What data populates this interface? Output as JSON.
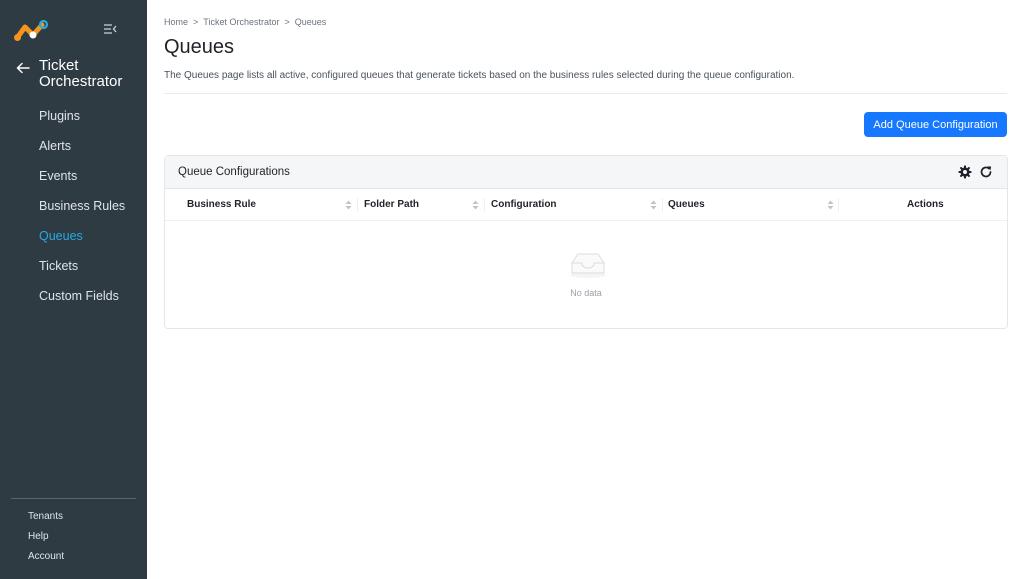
{
  "sidebar": {
    "back_title": "Ticket Orchestrator",
    "items": [
      {
        "label": "Plugins"
      },
      {
        "label": "Alerts"
      },
      {
        "label": "Events"
      },
      {
        "label": "Business Rules"
      },
      {
        "label": "Queues",
        "active": true
      },
      {
        "label": "Tickets"
      },
      {
        "label": "Custom Fields"
      }
    ],
    "bottom_links": [
      "Tenants",
      "Help",
      "Account"
    ],
    "active_color": "#27a9e1",
    "background": "#2f3b43"
  },
  "breadcrumb": [
    "Home",
    "Ticket Orchestrator",
    "Queues"
  ],
  "breadcrumb_separator": ">",
  "page": {
    "title": "Queues",
    "description": "The Queues page lists all active, configured queues that generate tickets based on the business rules selected during the queue configuration.",
    "add_button_label": "Add Queue Configuration"
  },
  "card": {
    "title": "Queue Configurations",
    "tools": [
      "settings-icon",
      "refresh-icon"
    ],
    "columns": [
      "Business Rule",
      "Folder Path",
      "Configuration",
      "Queues",
      "Actions"
    ],
    "empty_text": "No data"
  },
  "colors": {
    "primary": "#1677ff",
    "active_nav": "#27a9e1"
  }
}
